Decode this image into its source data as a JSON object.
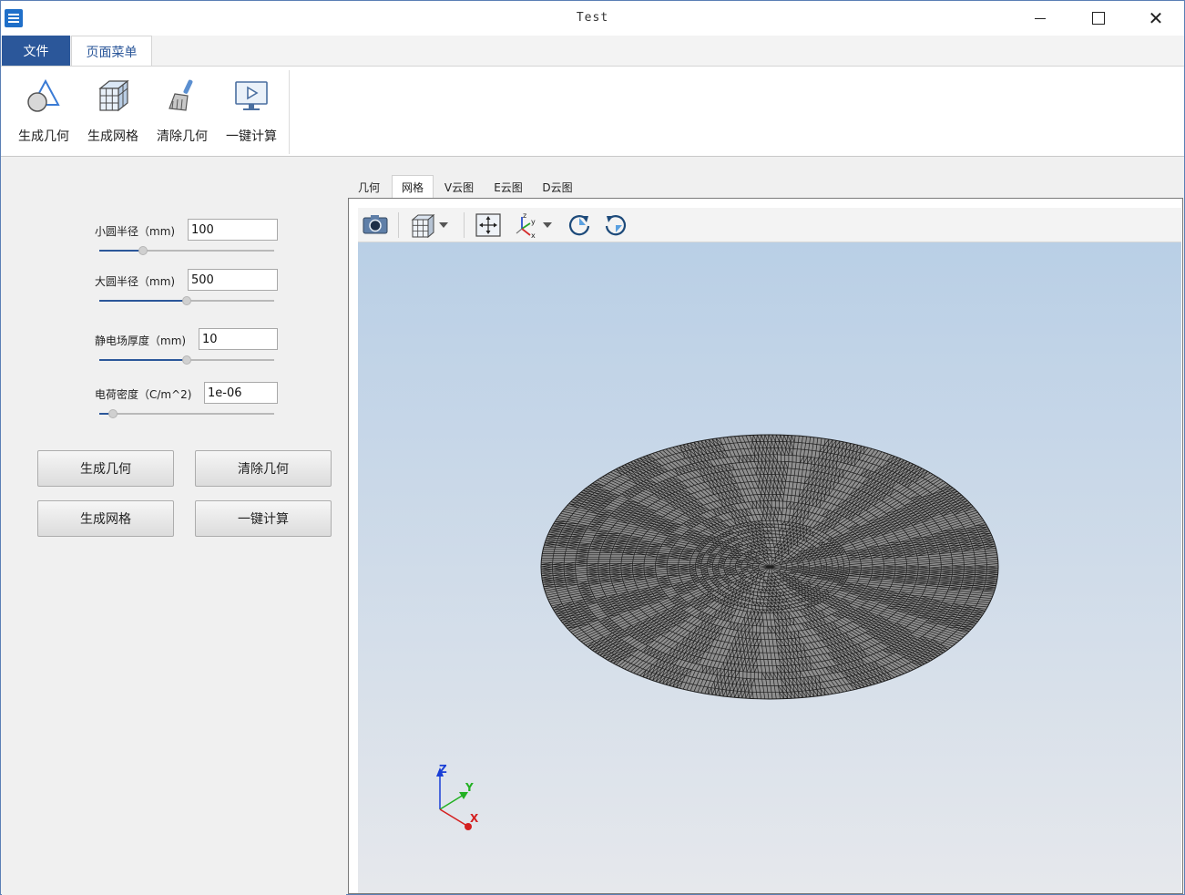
{
  "window": {
    "title": "Test"
  },
  "ribbon": {
    "tabs": [
      {
        "label": "文件"
      },
      {
        "label": "页面菜单"
      }
    ],
    "buttons": [
      {
        "label": "生成几何",
        "icon": "geometry-icon"
      },
      {
        "label": "生成网格",
        "icon": "mesh-cube-icon"
      },
      {
        "label": "清除几何",
        "icon": "broom-icon"
      },
      {
        "label": "一键计算",
        "icon": "play-screen-icon"
      }
    ]
  },
  "params": {
    "small_radius": {
      "label": "小圆半径（mm)",
      "value": "100",
      "level": 0.25
    },
    "large_radius": {
      "label": "大圆半径（mm)",
      "value": "500",
      "level": 0.5
    },
    "thickness": {
      "label": "静电场厚度（mm)",
      "value": "10",
      "level": 0.5
    },
    "charge_density": {
      "label": "电荷密度（C/m^2)",
      "value": "1e-06",
      "level": 0.08
    }
  },
  "actions": {
    "gen_geometry": "生成几何",
    "clear_geometry": "清除几何",
    "gen_mesh": "生成网格",
    "compute": "一键计算"
  },
  "view_tabs": [
    {
      "label": "几何",
      "active": false
    },
    {
      "label": "网格",
      "active": true
    },
    {
      "label": "V云图",
      "active": false
    },
    {
      "label": "E云图",
      "active": false
    },
    {
      "label": "D云图",
      "active": false
    }
  ],
  "toolbar": [
    {
      "icon": "camera-icon"
    },
    {
      "icon": "view-cube-icon"
    },
    {
      "icon": "fit-view-icon"
    },
    {
      "icon": "axes-orient-icon"
    },
    {
      "icon": "rotate-cw-icon"
    },
    {
      "icon": "rotate-ccw-icon"
    }
  ],
  "axes": {
    "x": "X",
    "y": "Y",
    "z": "Z"
  },
  "colors": {
    "accent": "#2b579a",
    "mesh_fill": "#8f8f8f",
    "mesh_line": "#1e1e1e"
  }
}
